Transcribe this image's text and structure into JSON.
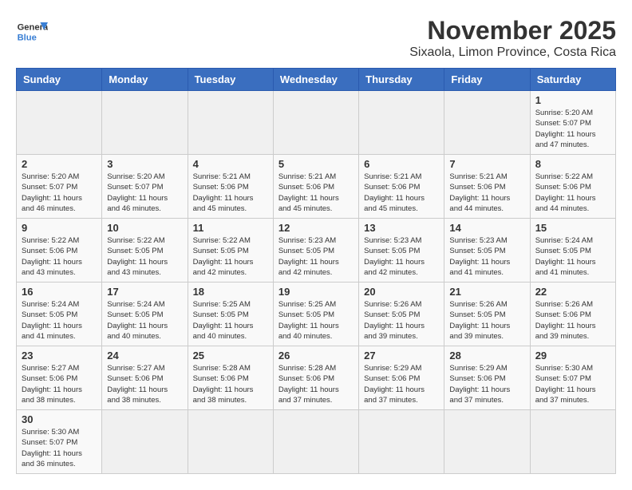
{
  "header": {
    "logo_line1": "General",
    "logo_line2": "Blue",
    "month_title": "November 2025",
    "location": "Sixaola, Limon Province, Costa Rica"
  },
  "days_of_week": [
    "Sunday",
    "Monday",
    "Tuesday",
    "Wednesday",
    "Thursday",
    "Friday",
    "Saturday"
  ],
  "weeks": [
    [
      {
        "day": "",
        "info": ""
      },
      {
        "day": "",
        "info": ""
      },
      {
        "day": "",
        "info": ""
      },
      {
        "day": "",
        "info": ""
      },
      {
        "day": "",
        "info": ""
      },
      {
        "day": "",
        "info": ""
      },
      {
        "day": "1",
        "info": "Sunrise: 5:20 AM\nSunset: 5:07 PM\nDaylight: 11 hours and 47 minutes."
      }
    ],
    [
      {
        "day": "2",
        "info": "Sunrise: 5:20 AM\nSunset: 5:07 PM\nDaylight: 11 hours and 46 minutes."
      },
      {
        "day": "3",
        "info": "Sunrise: 5:20 AM\nSunset: 5:07 PM\nDaylight: 11 hours and 46 minutes."
      },
      {
        "day": "4",
        "info": "Sunrise: 5:21 AM\nSunset: 5:06 PM\nDaylight: 11 hours and 45 minutes."
      },
      {
        "day": "5",
        "info": "Sunrise: 5:21 AM\nSunset: 5:06 PM\nDaylight: 11 hours and 45 minutes."
      },
      {
        "day": "6",
        "info": "Sunrise: 5:21 AM\nSunset: 5:06 PM\nDaylight: 11 hours and 45 minutes."
      },
      {
        "day": "7",
        "info": "Sunrise: 5:21 AM\nSunset: 5:06 PM\nDaylight: 11 hours and 44 minutes."
      },
      {
        "day": "8",
        "info": "Sunrise: 5:22 AM\nSunset: 5:06 PM\nDaylight: 11 hours and 44 minutes."
      }
    ],
    [
      {
        "day": "9",
        "info": "Sunrise: 5:22 AM\nSunset: 5:06 PM\nDaylight: 11 hours and 43 minutes."
      },
      {
        "day": "10",
        "info": "Sunrise: 5:22 AM\nSunset: 5:05 PM\nDaylight: 11 hours and 43 minutes."
      },
      {
        "day": "11",
        "info": "Sunrise: 5:22 AM\nSunset: 5:05 PM\nDaylight: 11 hours and 42 minutes."
      },
      {
        "day": "12",
        "info": "Sunrise: 5:23 AM\nSunset: 5:05 PM\nDaylight: 11 hours and 42 minutes."
      },
      {
        "day": "13",
        "info": "Sunrise: 5:23 AM\nSunset: 5:05 PM\nDaylight: 11 hours and 42 minutes."
      },
      {
        "day": "14",
        "info": "Sunrise: 5:23 AM\nSunset: 5:05 PM\nDaylight: 11 hours and 41 minutes."
      },
      {
        "day": "15",
        "info": "Sunrise: 5:24 AM\nSunset: 5:05 PM\nDaylight: 11 hours and 41 minutes."
      }
    ],
    [
      {
        "day": "16",
        "info": "Sunrise: 5:24 AM\nSunset: 5:05 PM\nDaylight: 11 hours and 41 minutes."
      },
      {
        "day": "17",
        "info": "Sunrise: 5:24 AM\nSunset: 5:05 PM\nDaylight: 11 hours and 40 minutes."
      },
      {
        "day": "18",
        "info": "Sunrise: 5:25 AM\nSunset: 5:05 PM\nDaylight: 11 hours and 40 minutes."
      },
      {
        "day": "19",
        "info": "Sunrise: 5:25 AM\nSunset: 5:05 PM\nDaylight: 11 hours and 40 minutes."
      },
      {
        "day": "20",
        "info": "Sunrise: 5:26 AM\nSunset: 5:05 PM\nDaylight: 11 hours and 39 minutes."
      },
      {
        "day": "21",
        "info": "Sunrise: 5:26 AM\nSunset: 5:05 PM\nDaylight: 11 hours and 39 minutes."
      },
      {
        "day": "22",
        "info": "Sunrise: 5:26 AM\nSunset: 5:06 PM\nDaylight: 11 hours and 39 minutes."
      }
    ],
    [
      {
        "day": "23",
        "info": "Sunrise: 5:27 AM\nSunset: 5:06 PM\nDaylight: 11 hours and 38 minutes."
      },
      {
        "day": "24",
        "info": "Sunrise: 5:27 AM\nSunset: 5:06 PM\nDaylight: 11 hours and 38 minutes."
      },
      {
        "day": "25",
        "info": "Sunrise: 5:28 AM\nSunset: 5:06 PM\nDaylight: 11 hours and 38 minutes."
      },
      {
        "day": "26",
        "info": "Sunrise: 5:28 AM\nSunset: 5:06 PM\nDaylight: 11 hours and 37 minutes."
      },
      {
        "day": "27",
        "info": "Sunrise: 5:29 AM\nSunset: 5:06 PM\nDaylight: 11 hours and 37 minutes."
      },
      {
        "day": "28",
        "info": "Sunrise: 5:29 AM\nSunset: 5:06 PM\nDaylight: 11 hours and 37 minutes."
      },
      {
        "day": "29",
        "info": "Sunrise: 5:30 AM\nSunset: 5:07 PM\nDaylight: 11 hours and 37 minutes."
      }
    ],
    [
      {
        "day": "30",
        "info": "Sunrise: 5:30 AM\nSunset: 5:07 PM\nDaylight: 11 hours and 36 minutes."
      },
      {
        "day": "",
        "info": ""
      },
      {
        "day": "",
        "info": ""
      },
      {
        "day": "",
        "info": ""
      },
      {
        "day": "",
        "info": ""
      },
      {
        "day": "",
        "info": ""
      },
      {
        "day": "",
        "info": ""
      }
    ]
  ]
}
